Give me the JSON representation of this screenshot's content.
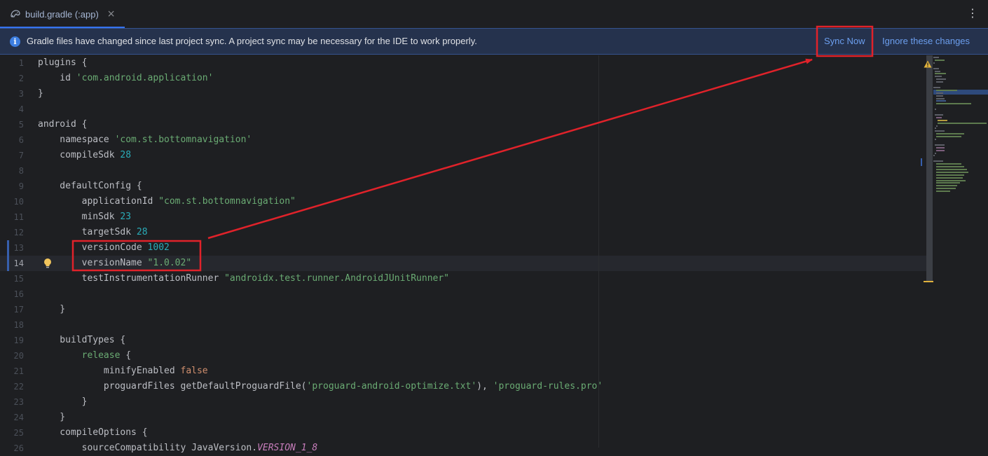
{
  "tab": {
    "label": "build.gradle (:app)",
    "close": "×"
  },
  "menu": {
    "kebab": "⋮"
  },
  "banner": {
    "message": "Gradle files have changed since last project sync. A project sync may be necessary for the IDE to work properly.",
    "sync_label": "Sync Now",
    "ignore_label": "Ignore these changes"
  },
  "editor": {
    "current_line": 14,
    "lines": [
      {
        "n": "1",
        "tokens": [
          [
            "t",
            "plugins {"
          ]
        ]
      },
      {
        "n": "2",
        "tokens": [
          [
            "t",
            "    id "
          ],
          [
            "str",
            "'com.android.application'"
          ]
        ]
      },
      {
        "n": "3",
        "tokens": [
          [
            "t",
            "}"
          ]
        ]
      },
      {
        "n": "4",
        "tokens": []
      },
      {
        "n": "5",
        "tokens": [
          [
            "t",
            "android {"
          ]
        ]
      },
      {
        "n": "6",
        "tokens": [
          [
            "t",
            "    namespace "
          ],
          [
            "str",
            "'com.st.bottomnavigation'"
          ]
        ]
      },
      {
        "n": "7",
        "tokens": [
          [
            "t",
            "    compileSdk "
          ],
          [
            "num",
            "28"
          ]
        ]
      },
      {
        "n": "8",
        "tokens": []
      },
      {
        "n": "9",
        "tokens": [
          [
            "t",
            "    defaultConfig {"
          ]
        ]
      },
      {
        "n": "10",
        "tokens": [
          [
            "t",
            "        applicationId "
          ],
          [
            "str",
            "\"com.st.bottomnavigation\""
          ]
        ]
      },
      {
        "n": "11",
        "tokens": [
          [
            "t",
            "        minSdk "
          ],
          [
            "num",
            "23"
          ]
        ]
      },
      {
        "n": "12",
        "tokens": [
          [
            "t",
            "        targetSdk "
          ],
          [
            "num",
            "28"
          ]
        ]
      },
      {
        "n": "13",
        "tokens": [
          [
            "t",
            "        versionCode "
          ],
          [
            "num",
            "1002"
          ]
        ]
      },
      {
        "n": "14",
        "tokens": [
          [
            "t",
            "        versionName "
          ],
          [
            "str",
            "\"1.0.02\""
          ]
        ]
      },
      {
        "n": "15",
        "tokens": [
          [
            "t",
            "        testInstrumentationRunner "
          ],
          [
            "str",
            "\"androidx.test.runner.AndroidJUnitRunner\""
          ]
        ]
      },
      {
        "n": "16",
        "tokens": []
      },
      {
        "n": "17",
        "tokens": [
          [
            "t",
            "    }"
          ]
        ]
      },
      {
        "n": "18",
        "tokens": []
      },
      {
        "n": "19",
        "tokens": [
          [
            "t",
            "    buildTypes {"
          ]
        ]
      },
      {
        "n": "20",
        "tokens": [
          [
            "t",
            "        "
          ],
          [
            "prop",
            "release"
          ],
          [
            "t",
            " {"
          ]
        ]
      },
      {
        "n": "21",
        "tokens": [
          [
            "t",
            "            minifyEnabled "
          ],
          [
            "kw",
            "false"
          ]
        ]
      },
      {
        "n": "22",
        "tokens": [
          [
            "t",
            "            proguardFiles getDefaultProguardFile("
          ],
          [
            "str",
            "'proguard-android-optimize.txt'"
          ],
          [
            "t",
            "), "
          ],
          [
            "str",
            "'proguard-rules.pro'"
          ]
        ]
      },
      {
        "n": "23",
        "tokens": [
          [
            "t",
            "        }"
          ]
        ]
      },
      {
        "n": "24",
        "tokens": [
          [
            "t",
            "    }"
          ]
        ]
      },
      {
        "n": "25",
        "tokens": [
          [
            "t",
            "    compileOptions {"
          ]
        ]
      },
      {
        "n": "26",
        "tokens": [
          [
            "t",
            "        sourceCompatibility JavaVersion."
          ],
          [
            "static",
            "VERSION_1_8"
          ]
        ]
      }
    ]
  },
  "colors": {
    "accent": "#3574f0",
    "annotation": "#e0222a",
    "banner_bg": "#25324d",
    "link": "#6c9fef"
  }
}
